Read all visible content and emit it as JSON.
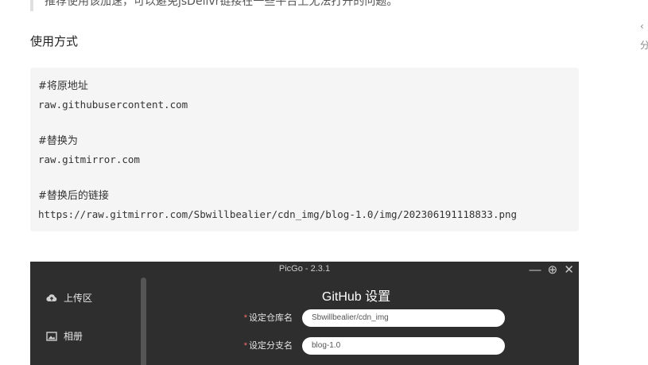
{
  "article": {
    "quote_text": "推荐使用该加速，可以避免jsDelivr链接在一些平台上无法打开的问题。",
    "side_glyphs": [
      "‹",
      "分"
    ],
    "section_heading": "使用方式",
    "code_lines": [
      {
        "text": "#将原地址",
        "kind": "comment"
      },
      {
        "text": "raw.githubusercontent.com",
        "kind": "code"
      },
      {
        "text": "",
        "kind": "blank"
      },
      {
        "text": "#替换为",
        "kind": "comment"
      },
      {
        "text": "raw.gitmirror.com",
        "kind": "code"
      },
      {
        "text": "",
        "kind": "blank"
      },
      {
        "text": "#替换后的链接",
        "kind": "comment"
      },
      {
        "text": "https://raw.gitmirror.com/Sbwillbealier/cdn_img/blog-1.0/img/202306191118833.png",
        "kind": "code"
      }
    ]
  },
  "picgo": {
    "window_title": "PicGo - 2.3.1",
    "controls": {
      "minimize": "—",
      "maximize": "⊕",
      "close": "✕"
    },
    "sidebar": [
      {
        "label": "上传区",
        "icon": "cloud-upload-icon"
      },
      {
        "label": "相册",
        "icon": "image-icon"
      }
    ],
    "page_title": "GitHub 设置",
    "fields": [
      {
        "label": "设定仓库名",
        "value": "Sbwillbealier/cdn_img",
        "required_mark": "*"
      },
      {
        "label": "设定分支名",
        "value": "blog-1.0",
        "required_mark": "*"
      }
    ]
  }
}
